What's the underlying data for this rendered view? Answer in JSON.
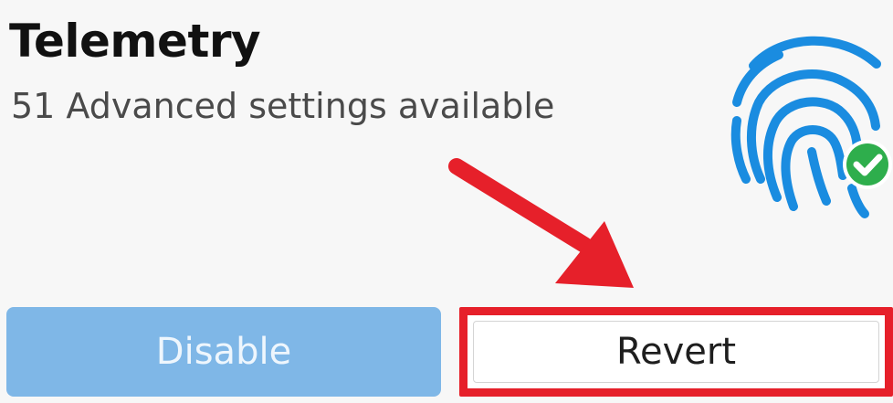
{
  "card": {
    "title": "Telemetry",
    "subtitle": "51 Advanced settings available",
    "status_icon": "check-icon",
    "main_icon": "fingerprint-icon"
  },
  "buttons": {
    "disable_label": "Disable",
    "revert_label": "Revert"
  },
  "colors": {
    "accent_blue": "#1a8ce0",
    "disabled_button": "#7fb7e7",
    "highlight_red": "#e6202a",
    "success_green": "#2eae4c"
  }
}
